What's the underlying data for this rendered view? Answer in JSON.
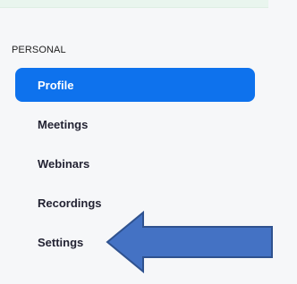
{
  "sidebar": {
    "section_heading": "PERSONAL",
    "items": [
      {
        "label": "Profile",
        "active": true
      },
      {
        "label": "Meetings",
        "active": false
      },
      {
        "label": "Webinars",
        "active": false
      },
      {
        "label": "Recordings",
        "active": false
      },
      {
        "label": "Settings",
        "active": false
      }
    ]
  },
  "annotation": {
    "icon": "left-arrow-icon",
    "fill_color": "#4472c4",
    "stroke_color": "#2f528f"
  },
  "colors": {
    "accent": "#0e72ed",
    "text": "#232333"
  }
}
